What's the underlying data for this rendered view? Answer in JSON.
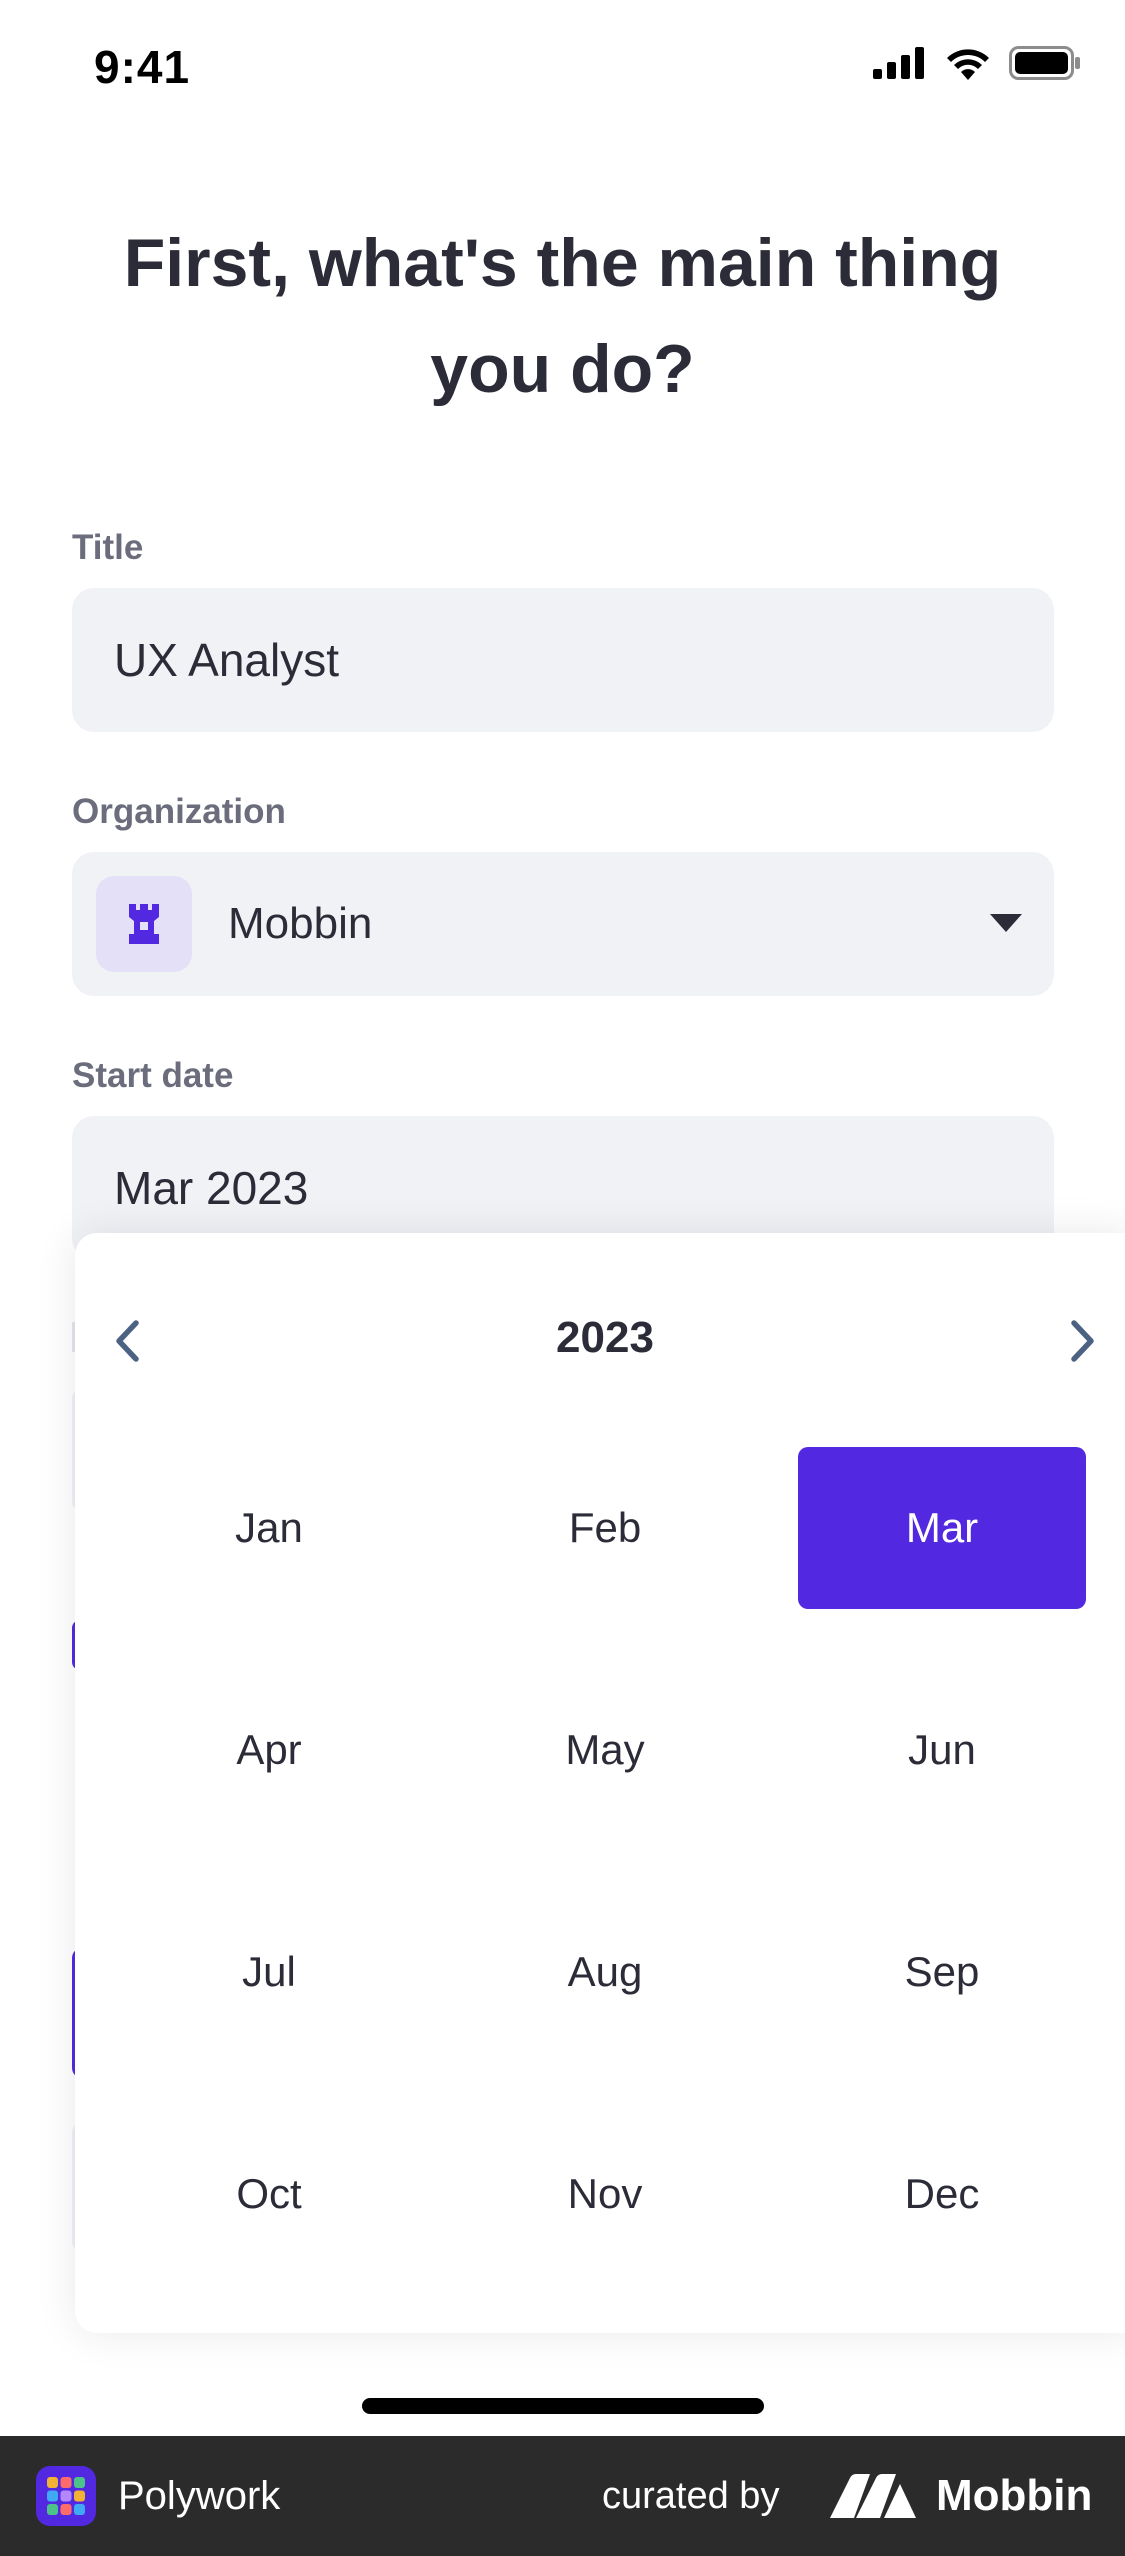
{
  "status_bar": {
    "time": "9:41"
  },
  "heading": "First, what's the main thing you do?",
  "form": {
    "title_label": "Title",
    "title_value": "UX Analyst",
    "organization_label": "Organization",
    "organization_value": "Mobbin",
    "start_date_label": "Start date",
    "start_date_value": "Mar 2023"
  },
  "month_picker": {
    "year": "2023",
    "selected_month": "Mar",
    "months": [
      "Jan",
      "Feb",
      "Mar",
      "Apr",
      "May",
      "Jun",
      "Jul",
      "Aug",
      "Sep",
      "Oct",
      "Nov",
      "Dec"
    ]
  },
  "footer": {
    "app_name": "Polywork",
    "curated_by": "curated by",
    "brand": "Mobbin"
  },
  "colors": {
    "accent": "#5229e0",
    "field_bg": "#f0f2f5",
    "text": "#2b2c38",
    "label": "#6b6d7c"
  }
}
